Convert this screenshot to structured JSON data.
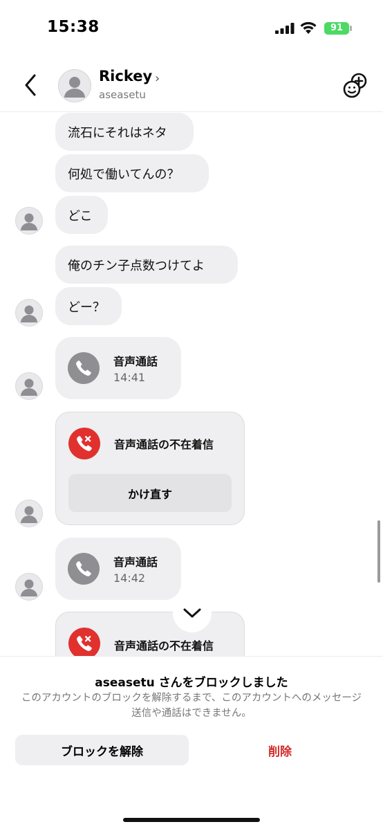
{
  "status_bar": {
    "time": "15:38",
    "battery": "91"
  },
  "header": {
    "name": "Rickey",
    "chevron": "›",
    "handle": "aseasetu"
  },
  "messages": [
    {
      "text": "流石にそれはネタ"
    },
    {
      "text": "何処で働いてんの？"
    },
    {
      "text": "どこ"
    },
    {
      "text": "俺のチン子点数つけてよ"
    },
    {
      "text": "どー？"
    }
  ],
  "calls": [
    {
      "title": "音声通話",
      "time": "14:41"
    },
    {
      "title": "音声通話の不在着信",
      "action": "かけ直す"
    },
    {
      "title": "音声通話",
      "time": "14:42"
    },
    {
      "title": "音声通話の不在着信"
    }
  ],
  "blocked": {
    "title": "aseasetu さんをブロックしました",
    "description": "このアカウントのブロックを解除するまで、このアカウントへのメッセージ送信や通話はできません。",
    "unblock_label": "ブロックを解除",
    "delete_label": "削除"
  },
  "colors": {
    "bubble": "#efeff1",
    "call_icon_gray": "#8e8e93",
    "missed_red": "#e0312f",
    "delete_red": "#d32a2a",
    "battery_green": "#4cd964"
  }
}
